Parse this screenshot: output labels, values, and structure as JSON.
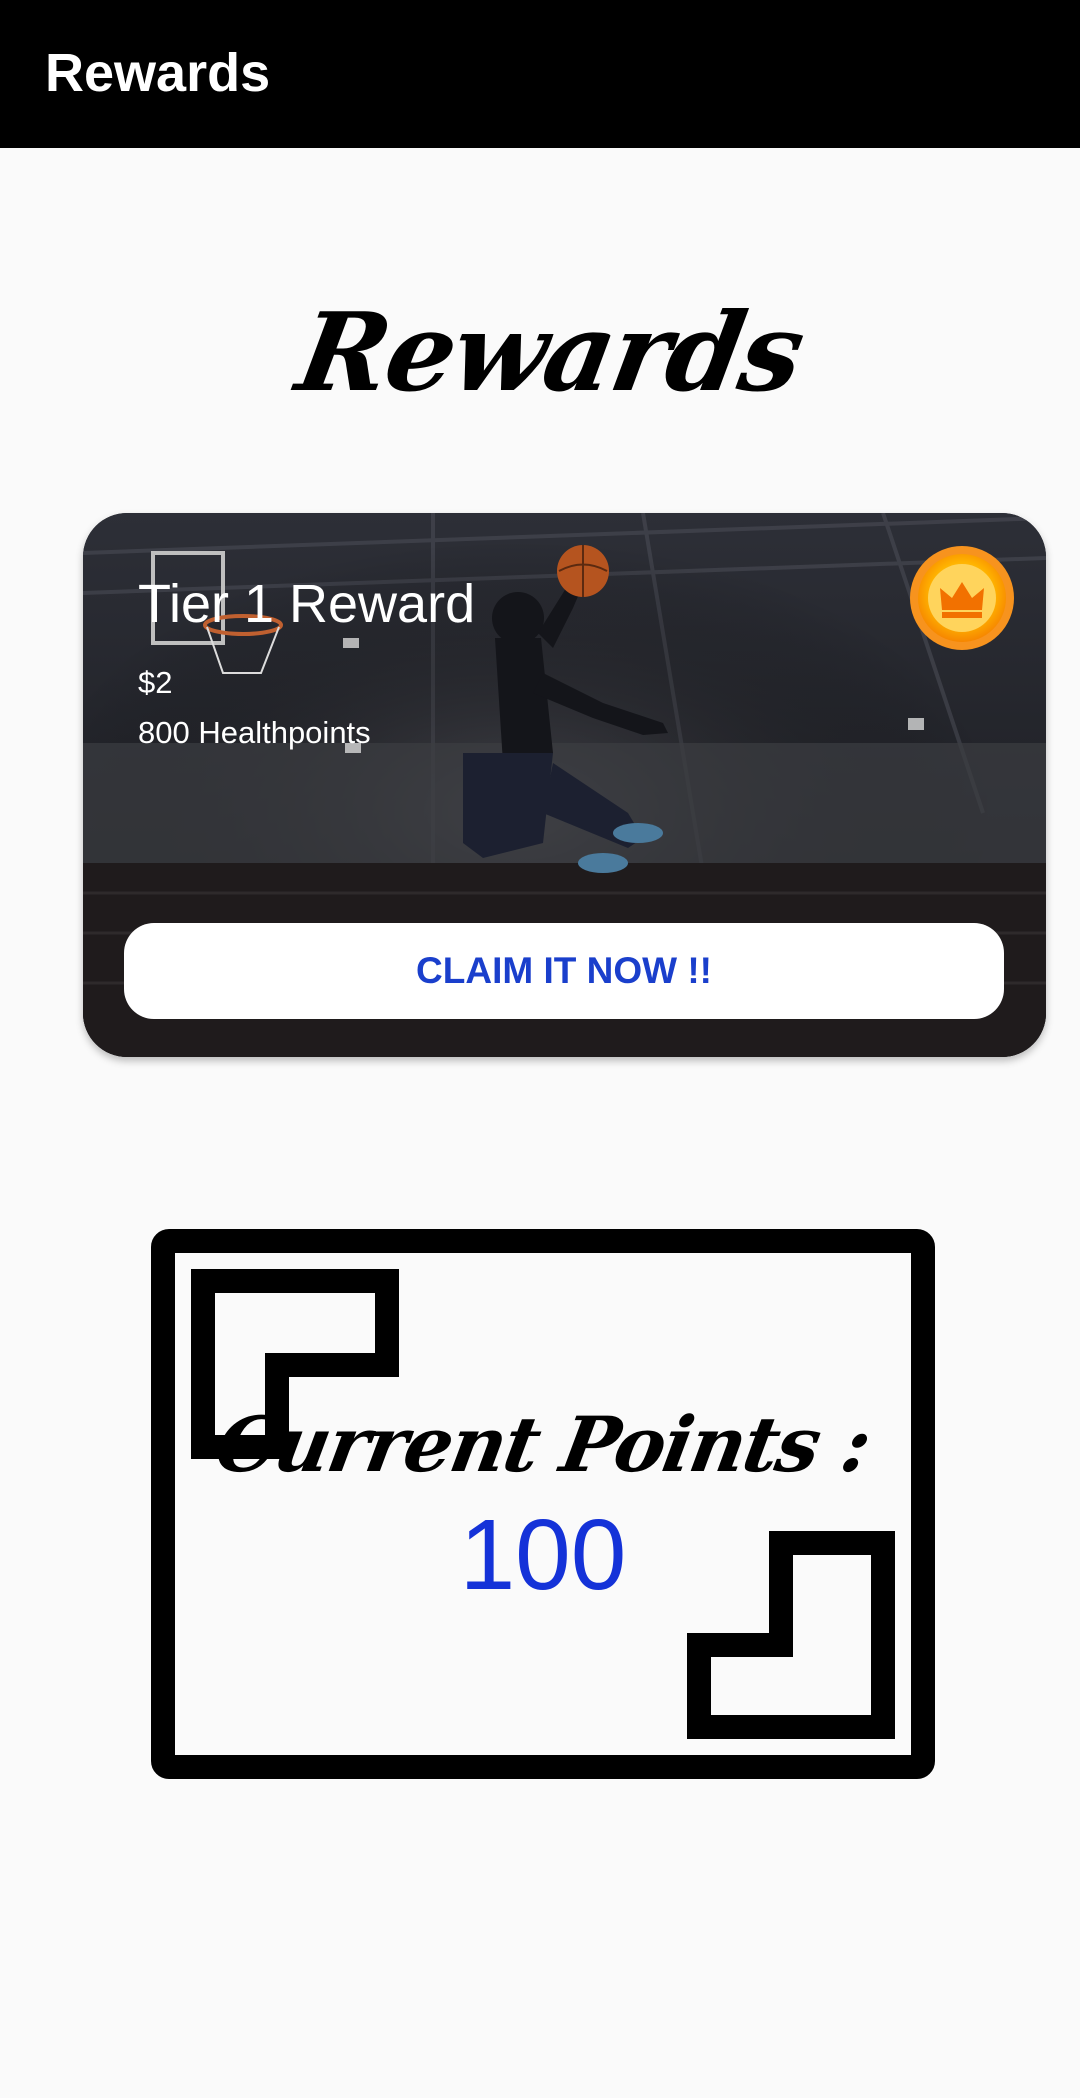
{
  "app_bar": {
    "title": "Rewards"
  },
  "page": {
    "heading": "Rewards"
  },
  "reward_card": {
    "title": "Tier 1 Reward",
    "price": "$2",
    "points": "800 Healthpoints",
    "claim_label": "CLAIM IT NOW !!",
    "badge_icon": "crown-icon"
  },
  "points_box": {
    "label": "Current Points :",
    "value": "100"
  },
  "colors": {
    "app_bar": "#000000",
    "background": "#fafafa",
    "accent_blue": "#1a3fcc",
    "badge_orange": "#f7931e",
    "badge_yellow": "#ffc94a"
  }
}
